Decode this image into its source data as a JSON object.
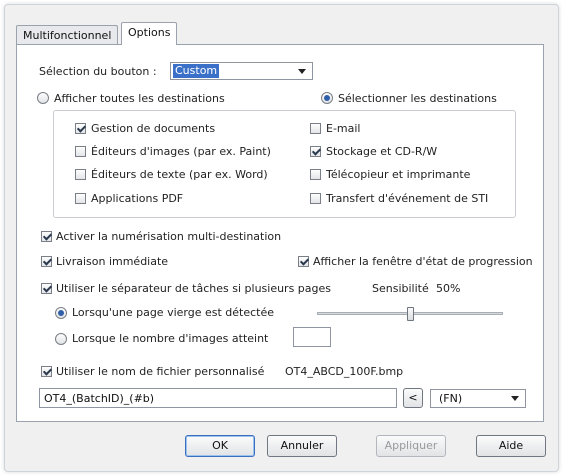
{
  "tabs": [
    {
      "label": "Multifonctionnel",
      "active": false
    },
    {
      "label": "Options",
      "active": true
    }
  ],
  "button_selection": {
    "label": "Sélection du bouton :",
    "value": "Custom"
  },
  "destinations_mode": {
    "show_all_label": "Afficher toutes les destinations",
    "select_label": "Sélectionner les destinations",
    "selected": "select"
  },
  "destinations": [
    {
      "label": "Gestion de documents",
      "checked": true
    },
    {
      "label": "E-mail",
      "checked": false
    },
    {
      "label": "Éditeurs d'images (par ex. Paint)",
      "checked": false
    },
    {
      "label": "Stockage et CD-R/W",
      "checked": true
    },
    {
      "label": "Éditeurs de texte (par ex. Word)",
      "checked": false
    },
    {
      "label": "Télécopieur et imprimante",
      "checked": false
    },
    {
      "label": "Applications PDF",
      "checked": false
    },
    {
      "label": "Transfert d'événement de STI",
      "checked": false
    }
  ],
  "options": {
    "multi_destination": {
      "label": "Activer la numérisation multi-destination",
      "checked": true
    },
    "immediate_delivery": {
      "label": "Livraison immédiate",
      "checked": true
    },
    "show_progress": {
      "label": "Afficher la fenêtre d'état de progression",
      "checked": true
    },
    "job_separator": {
      "label": "Utiliser le séparateur de tâches si plusieurs pages",
      "checked": true
    },
    "sensitivity_label": "Sensibilité",
    "sensitivity_value": "50%",
    "sensitivity_level": 0.5,
    "blank_page": {
      "label": "Lorsqu'une page vierge est détectée",
      "checked": true
    },
    "image_count": {
      "label": "Lorsque le nombre d'images atteint",
      "checked": false,
      "value": ""
    },
    "custom_filename": {
      "label": "Utiliser le nom de fichier personnalisé",
      "checked": true,
      "preview": "OT4_ABCD_100F.bmp"
    },
    "filename_pattern": "OT4_(BatchID)_(#b)",
    "insert_button": "<",
    "token_select": "(FN)"
  },
  "buttons": {
    "ok": "OK",
    "cancel": "Annuler",
    "apply": "Appliquer",
    "help": "Aide"
  }
}
